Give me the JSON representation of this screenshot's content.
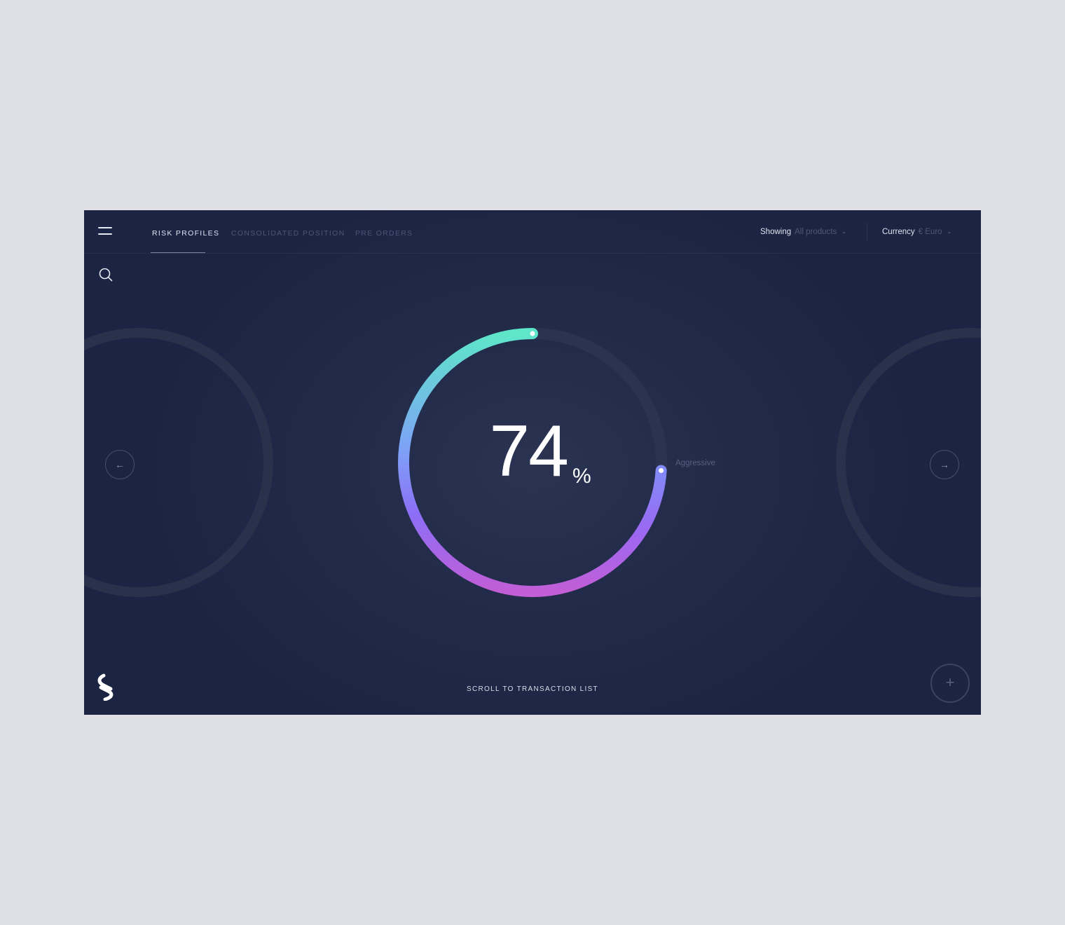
{
  "tabs": [
    {
      "label": "RISK PROFILES",
      "active": true
    },
    {
      "label": "CONSOLIDATED POSITION",
      "active": false
    },
    {
      "label": "PRE ORDERS",
      "active": false
    }
  ],
  "filters": {
    "showing_label": "Showing",
    "showing_value": "All products",
    "currency_label": "Currency",
    "currency_value": "€  Euro"
  },
  "gauge": {
    "value_text": "74",
    "unit": "%",
    "value": 74,
    "marker_label": "Aggressive"
  },
  "nav": {
    "prev": "←",
    "next": "→"
  },
  "footer": {
    "scroll_label": "SCROLL TO TRANSACTION LIST",
    "fab_symbol": "+"
  },
  "icons": [
    "menu-icon",
    "search-icon",
    "chevron-down-icon",
    "arrow-left-icon",
    "arrow-right-icon",
    "plus-icon",
    "brand-logo"
  ],
  "colors": {
    "background": "#1c2543",
    "gradient_start": "#5ee6c9",
    "gradient_mid": "#8b6cf6",
    "gradient_end": "#c45fd4",
    "track": "#2d3450"
  }
}
